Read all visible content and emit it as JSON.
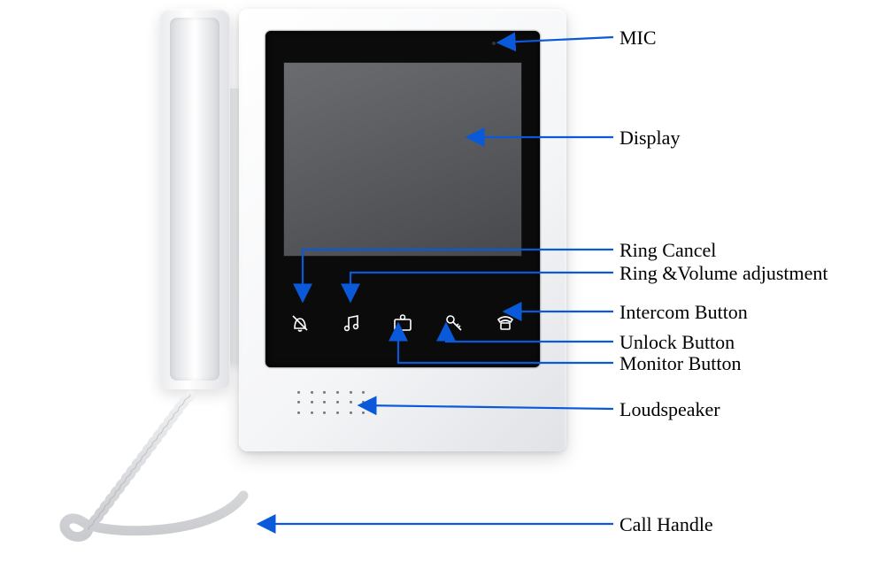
{
  "labels": {
    "mic": "MIC",
    "display": "Display",
    "ring_cancel": "Ring Cancel",
    "ring_volume": "Ring &Volume adjustment",
    "intercom": "Intercom Button",
    "unlock": "Unlock Button",
    "monitor": "Monitor Button",
    "loudspeaker": "Loudspeaker",
    "call_handle": "Call Handle"
  },
  "buttons": [
    {
      "name": "ring-cancel-icon",
      "label_key": "ring_cancel"
    },
    {
      "name": "ring-volume-icon",
      "label_key": "ring_volume"
    },
    {
      "name": "monitor-icon",
      "label_key": "monitor"
    },
    {
      "name": "unlock-icon",
      "label_key": "unlock"
    },
    {
      "name": "intercom-icon",
      "label_key": "intercom"
    }
  ],
  "colors": {
    "arrow": "#0a59da",
    "panel": "#0b0b0b",
    "display": "#5b5d61"
  }
}
